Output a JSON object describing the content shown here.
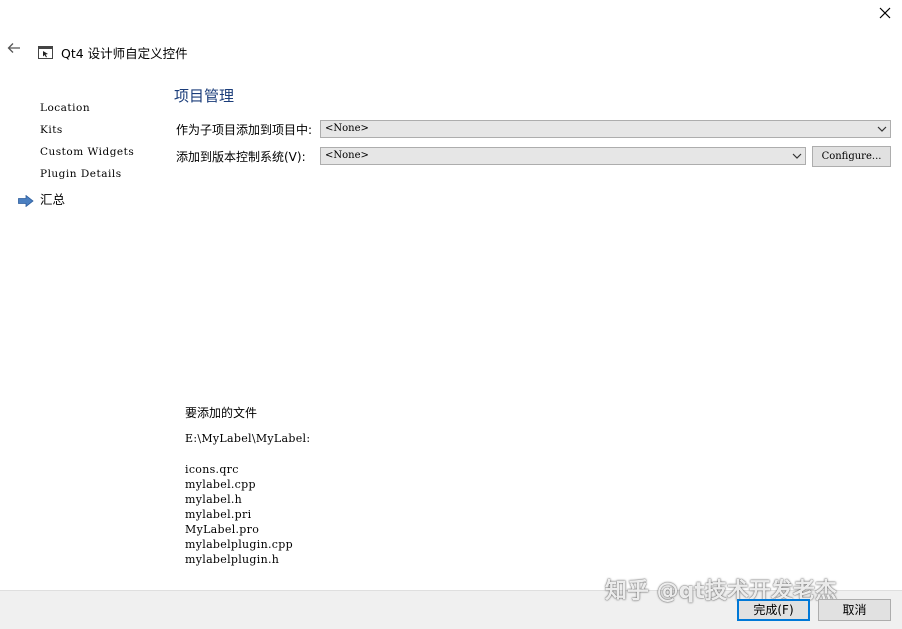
{
  "window": {
    "title": "Qt4 设计师自定义控件",
    "icons": {
      "close": "close-icon",
      "back": "back-arrow-icon",
      "app": "app-window-icon"
    }
  },
  "sidebar": {
    "items": [
      {
        "label": "Location",
        "active": false
      },
      {
        "label": "Kits",
        "active": false
      },
      {
        "label": "Custom Widgets",
        "active": false
      },
      {
        "label": "Plugin Details",
        "active": false
      },
      {
        "label": "汇总",
        "active": true
      }
    ],
    "active_indicator_icon": "right-arrow-icon",
    "active_indicator_color": "#4a7fc1"
  },
  "main": {
    "heading": "项目管理",
    "heading_color": "#1b3d7a",
    "add_to_project": {
      "label": "作为子项目添加到项目中:",
      "value": "<None>"
    },
    "version_control": {
      "label": "添加到版本控制系统(V):",
      "value": "<None>",
      "configure_label": "Configure..."
    }
  },
  "files": {
    "heading": "要添加的文件",
    "path": "E:\\MyLabel\\MyLabel:",
    "list": [
      "icons.qrc",
      "mylabel.cpp",
      "mylabel.h",
      "mylabel.pri",
      "MyLabel.pro",
      "mylabelplugin.cpp",
      "mylabelplugin.h"
    ]
  },
  "footer": {
    "finish_label": "完成(F)",
    "cancel_label": "取消",
    "focus_color": "#0078d7"
  },
  "watermark": "知乎 @qt技术开发老杰"
}
